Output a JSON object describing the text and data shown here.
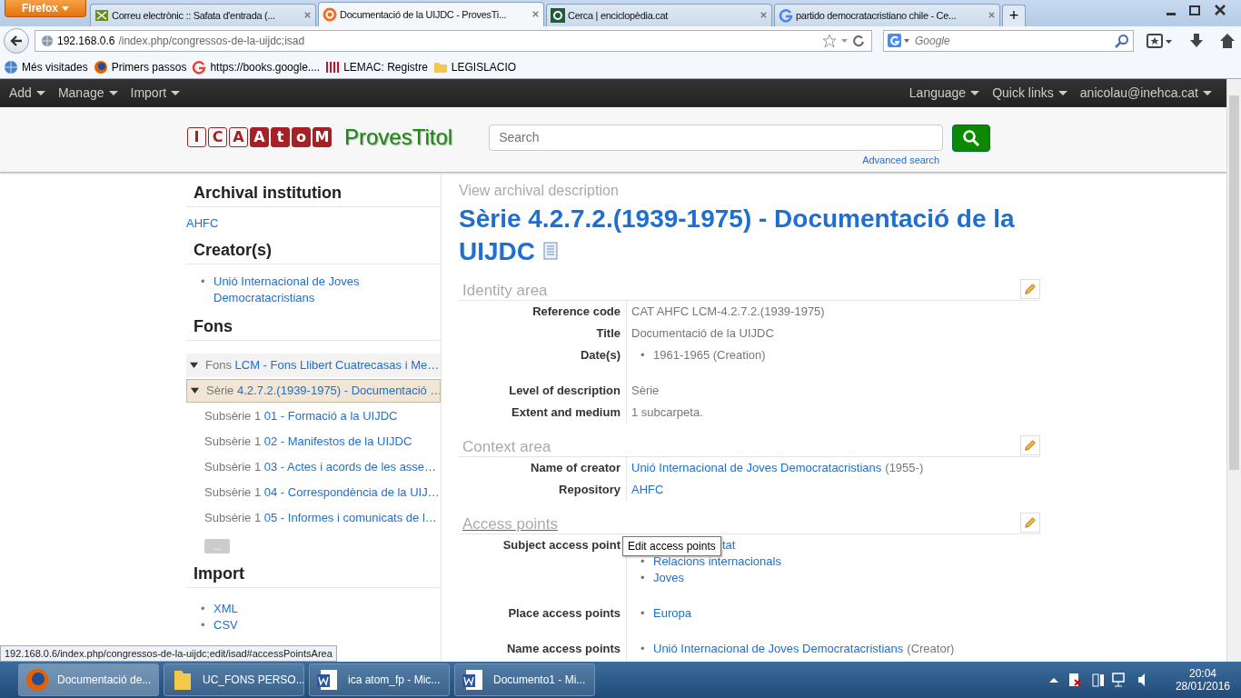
{
  "browser": {
    "menu_button": "Firefox",
    "tabs": [
      {
        "title": "Correu electrònic :: Safata d'entrada (...",
        "selected": false
      },
      {
        "title": "Documentació de la UIJDC - ProvesTi...",
        "selected": true
      },
      {
        "title": "Cerca | enciclopèdia.cat",
        "selected": false
      },
      {
        "title": "partido democratacristiano chile - Ce...",
        "selected": false
      }
    ],
    "new_tab": "+",
    "url_host": "192.168.0.6",
    "url_path": "/index.php/congressos-de-la-uijdc;isad",
    "search_placeholder": "Google",
    "bookmarks": [
      "Més visitades",
      "Primers passos",
      "https://books.google....",
      "LEMAC: Registre",
      "LEGISLACIO"
    ],
    "status_url": "192.168.0.6/index.php/congressos-de-la-uijdc;edit/isad#accessPointsArea"
  },
  "nav": {
    "left": [
      "Add",
      "Manage",
      "Import"
    ],
    "right": [
      "Language",
      "Quick links",
      "anicolau@inehca.cat"
    ]
  },
  "header": {
    "logo_letters": [
      {
        "char": "I",
        "filled": false
      },
      {
        "char": "C",
        "filled": false
      },
      {
        "char": "A",
        "filled": false
      },
      {
        "char": "A",
        "filled": true
      },
      {
        "char": "t",
        "filled": true
      },
      {
        "char": "o",
        "filled": true
      },
      {
        "char": "M",
        "filled": true
      }
    ],
    "site_name": "ProvesTitol",
    "search_placeholder": "Search",
    "advanced_search": "Advanced search"
  },
  "sidebar": {
    "institution_heading": "Archival institution",
    "institution": "AHFC",
    "creators_heading": "Creator(s)",
    "creators": [
      {
        "marker": "•",
        "text": "Unió Internacional de Joves Democratacristians"
      }
    ],
    "fons_heading": "Fons",
    "tree": [
      {
        "level": "Fons",
        "title": "LCM - Fons Llibert Cuatrecasas i Me…",
        "expanded": true,
        "selected": false,
        "children": [
          {
            "level": "Sèrie",
            "title": "4.2.7.2.(1939-1975) - Documentació …",
            "expanded": true,
            "selected": true,
            "children": [
              {
                "level": "Subsèrie 1",
                "title": "01 - Formació a la UIJDC",
                "selected": false
              },
              {
                "level": "Subsèrie 1",
                "title": "02 - Manifestos de la UIJDC",
                "selected": false
              },
              {
                "level": "Subsèrie 1",
                "title": "03 - Actes i acords de les asse…",
                "selected": false
              },
              {
                "level": "Subsèrie 1",
                "title": "04 - Correspondència de la UIJ…",
                "selected": false
              },
              {
                "level": "Subsèrie 1",
                "title": "05 - Informes i comunicats de l…",
                "selected": false
              }
            ]
          }
        ]
      }
    ],
    "more_button": "...",
    "import_heading": "Import",
    "import_links": [
      {
        "marker": "•",
        "text": "XML"
      },
      {
        "marker": "•",
        "text": "CSV"
      }
    ]
  },
  "main": {
    "breadcrumb": "View archival description",
    "title": "Sèrie 4.2.7.2.(1939-1975) - Documentació de la UIJDC",
    "areas": [
      {
        "title": "Identity area",
        "hovered": false,
        "fields": [
          {
            "label": "Reference code",
            "kind": "plain",
            "values": [
              {
                "text": "CAT AHFC LCM-4.2.7.2.(1939-1975)"
              }
            ]
          },
          {
            "label": "Title",
            "kind": "plain",
            "values": [
              {
                "text": "Documentació de la UIJDC"
              }
            ]
          },
          {
            "label": "Date(s)",
            "kind": "bullets",
            "values": [
              {
                "marker": "•",
                "text": "1961-1965 (Creation)"
              }
            ]
          },
          {
            "label": "Level of description",
            "kind": "plain",
            "values": [
              {
                "text": "Sèrie"
              }
            ]
          },
          {
            "label": "Extent and medium",
            "kind": "plain",
            "values": [
              {
                "text": "1 subcarpeta."
              }
            ]
          }
        ]
      },
      {
        "title": "Context area",
        "hovered": false,
        "fields": [
          {
            "label": "Name of creator",
            "kind": "plain",
            "values": [
              {
                "link": "Unió Internacional de Joves Democratacristians",
                "note": "(1955-)"
              }
            ]
          },
          {
            "label": "Repository",
            "kind": "plain",
            "values": [
              {
                "link": "AHFC"
              }
            ]
          }
        ]
      },
      {
        "title": "Access points",
        "hovered": true,
        "fields": [
          {
            "label": "Subject access point",
            "kind": "bullets",
            "values": [
              {
                "link": "tat"
              },
              {
                "marker": "•",
                "link": "Relacions internacionals"
              },
              {
                "marker": "•",
                "link": "Joves"
              }
            ]
          },
          {
            "label": "Place access points",
            "kind": "bullets",
            "values": [
              {
                "marker": "•",
                "link": "Europa"
              }
            ]
          },
          {
            "label": "Name access points",
            "kind": "bullets",
            "values": [
              {
                "marker": "•",
                "link": "Unió Internacional de Joves Democratacristians",
                "note": "(Creator)"
              }
            ]
          }
        ]
      }
    ],
    "tooltip": "Edit access points"
  },
  "taskbar": {
    "items": [
      {
        "label": "Documentació de...",
        "selected": true
      },
      {
        "label": "UC_FONS PERSO...",
        "selected": false
      },
      {
        "label": "ica atom_fp - Mic...",
        "selected": false
      },
      {
        "label": "Documento1 - Mi...",
        "selected": false
      }
    ],
    "time": "20:04",
    "date": "28/01/2016"
  }
}
